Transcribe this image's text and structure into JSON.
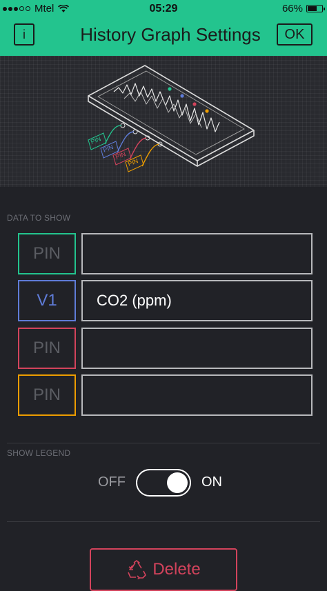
{
  "status": {
    "carrier": "Mtel",
    "time": "05:29",
    "battery": "66%",
    "battery_level": 0.66
  },
  "header": {
    "info_label": "i",
    "title": "History Graph Settings",
    "ok_label": "OK"
  },
  "illustration": {
    "pin_tags": [
      "PIN",
      "PIN",
      "PIN",
      "PIN"
    ]
  },
  "data_section": {
    "label": "DATA TO SHOW",
    "rows": [
      {
        "pin": "PIN",
        "value": "",
        "color": "#23c48e"
      },
      {
        "pin": "V1",
        "value": "CO2 (ppm)",
        "color": "#5f7cd8"
      },
      {
        "pin": "PIN",
        "value": "",
        "color": "#d3435c"
      },
      {
        "pin": "PIN",
        "value": "",
        "color": "#ed9d00"
      }
    ]
  },
  "legend": {
    "label": "SHOW LEGEND",
    "off_label": "OFF",
    "on_label": "ON",
    "enabled": true
  },
  "delete_label": "Delete",
  "colors": {
    "accent": "#23c48e",
    "background": "#212227",
    "danger": "#d3435c"
  }
}
